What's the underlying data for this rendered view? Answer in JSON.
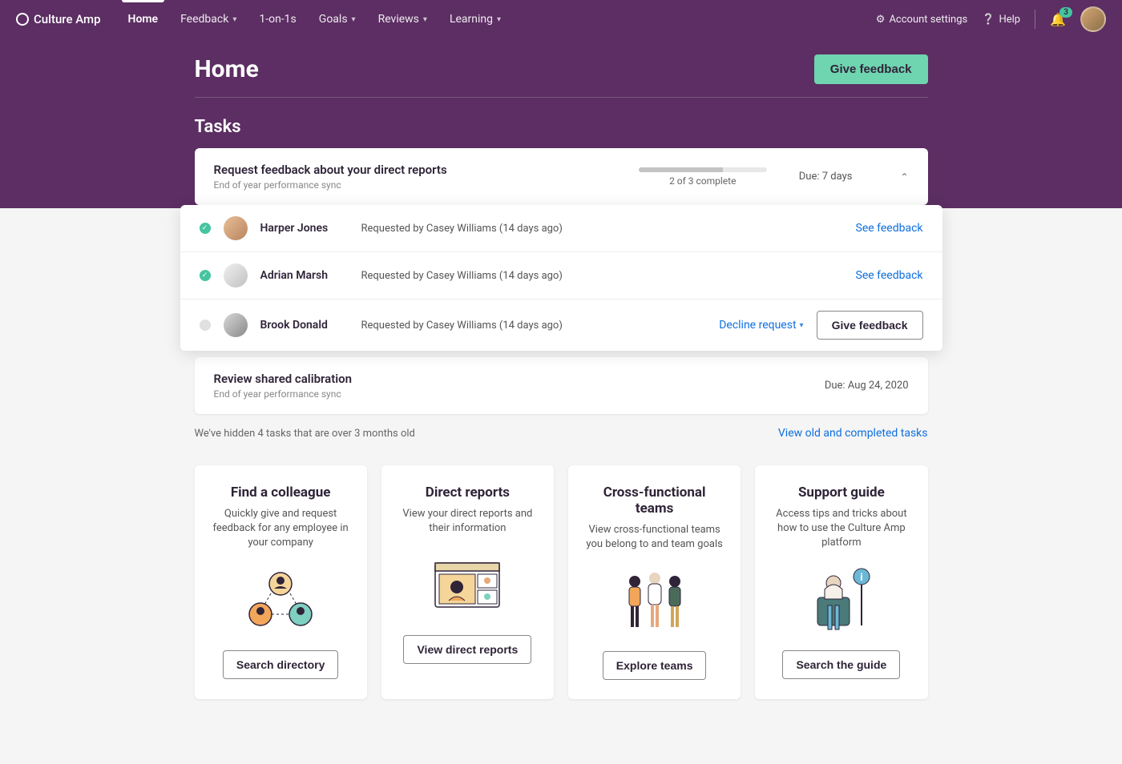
{
  "brand": "Culture Amp",
  "nav": {
    "items": [
      {
        "label": "Home",
        "active": true,
        "dropdown": false
      },
      {
        "label": "Feedback",
        "active": false,
        "dropdown": true
      },
      {
        "label": "1-on-1s",
        "active": false,
        "dropdown": false
      },
      {
        "label": "Goals",
        "active": false,
        "dropdown": true
      },
      {
        "label": "Reviews",
        "active": false,
        "dropdown": true
      },
      {
        "label": "Learning",
        "active": false,
        "dropdown": true
      }
    ],
    "account_settings": "Account settings",
    "help": "Help",
    "notification_count": "3"
  },
  "page": {
    "title": "Home",
    "give_feedback_btn": "Give feedback"
  },
  "tasks": {
    "heading": "Tasks",
    "task1": {
      "title": "Request feedback about your direct reports",
      "subtitle": "End of year performance sync",
      "progress_text": "2 of 3 complete",
      "progress_pct": 66,
      "due": "Due: 7 days",
      "rows": [
        {
          "name": "Harper Jones",
          "meta": "Requested by Casey Williams (14 days ago)",
          "status": "done",
          "action_link": "See feedback"
        },
        {
          "name": "Adrian Marsh",
          "meta": "Requested by Casey Williams (14 days ago)",
          "status": "done",
          "action_link": "See feedback"
        },
        {
          "name": "Brook Donald",
          "meta": "Requested by Casey Williams (14 days ago)",
          "status": "pending",
          "decline": "Decline request",
          "action_btn": "Give feedback"
        }
      ]
    },
    "task2": {
      "title": "Review shared calibration",
      "subtitle": "End of year performance sync",
      "due": "Due: Aug 24, 2020"
    },
    "hidden_text": "We've hidden 4 tasks that are over 3 months old",
    "view_old_link": "View old and completed tasks"
  },
  "quick": [
    {
      "title": "Find a colleague",
      "desc": "Quickly give and request feedback for any employee in your company",
      "btn": "Search directory"
    },
    {
      "title": "Direct reports",
      "desc": "View your direct reports and their information",
      "btn": "View direct reports"
    },
    {
      "title": "Cross-functional teams",
      "desc": "View cross-functional teams you belong to and team goals",
      "btn": "Explore teams"
    },
    {
      "title": "Support guide",
      "desc": "Access tips and tricks about how to use the Culture Amp platform",
      "btn": "Search the guide"
    }
  ]
}
